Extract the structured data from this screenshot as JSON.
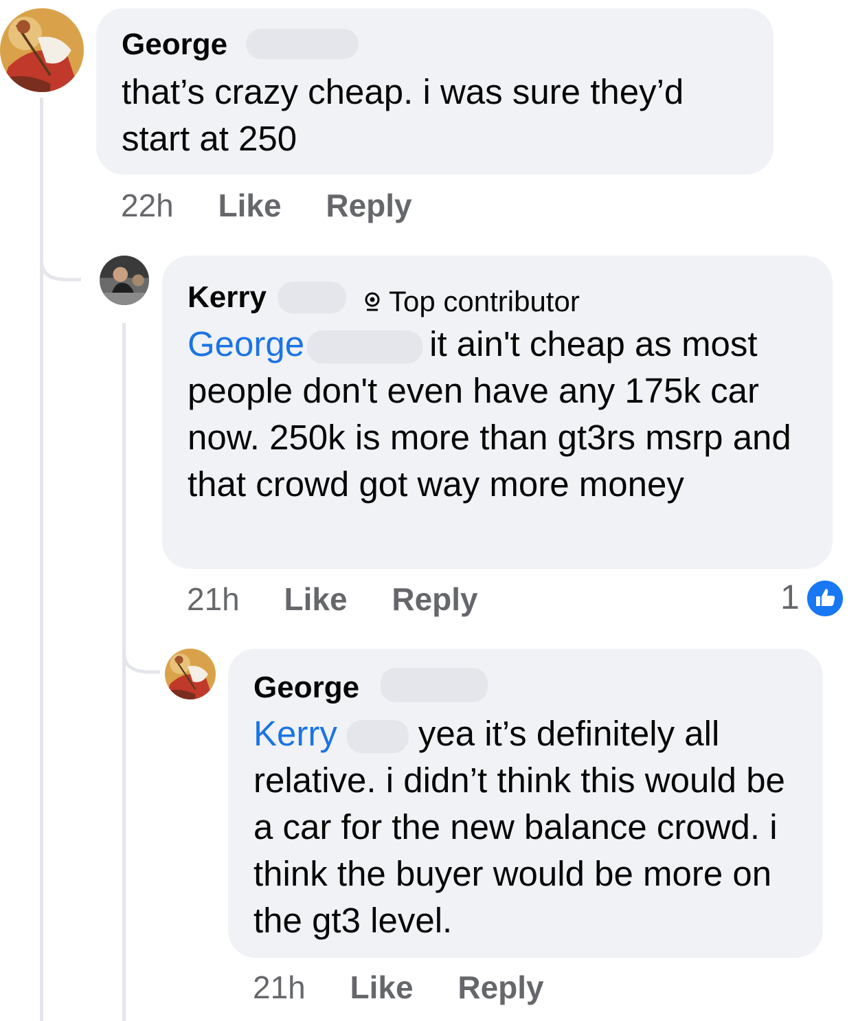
{
  "comment1": {
    "author": "George",
    "text": "that’s crazy cheap. i was sure they’d start at 250",
    "time": "22h",
    "like_label": "Like",
    "reply_label": "Reply"
  },
  "comment2": {
    "author": "Kerry",
    "badge": "Top contributor",
    "mention": "George",
    "text_first": "it ain't cheap as most",
    "text_rest": "people don't even have any 175k car now.  250k is more than gt3rs msrp and that crowd got way more money",
    "time": "21h",
    "like_label": "Like",
    "reply_label": "Reply",
    "reaction_count": "1"
  },
  "comment3": {
    "author": "George",
    "mention": "Kerry",
    "text_first": "yea it’s definitely all",
    "text_rest": "relative. i didn’t think this would be a car for the new balance crowd. i think the buyer would be more on the gt3 level.",
    "time": "21h",
    "like_label": "Like",
    "reply_label": "Reply"
  }
}
